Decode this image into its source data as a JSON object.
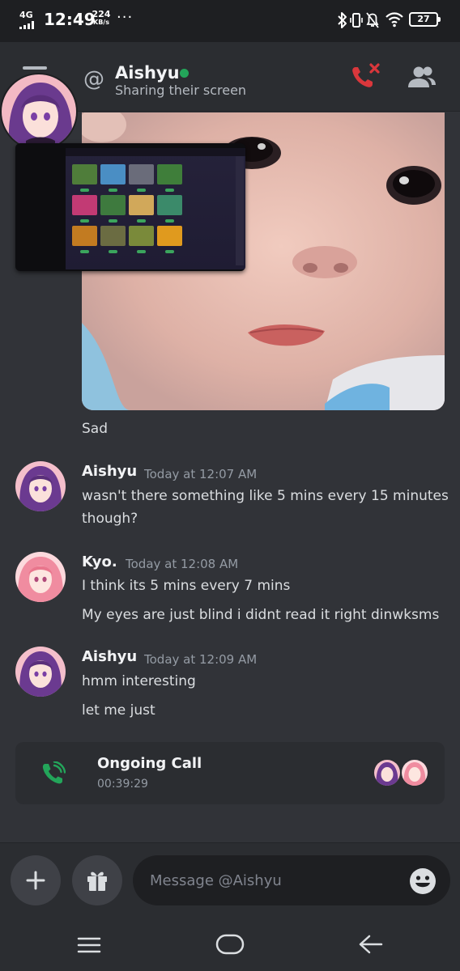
{
  "status_bar": {
    "network": "4G",
    "time": "12:49",
    "speed_value": "224",
    "speed_unit": "KB/s",
    "more": "···",
    "battery": "27",
    "icons": [
      "signal-icon",
      "bluetooth-icon",
      "vibrate-icon",
      "mute-bell-icon",
      "wifi-icon",
      "battery-icon"
    ]
  },
  "header": {
    "at_symbol": "@",
    "name": "Aishyu",
    "subtitle": "Sharing their screen",
    "status_color": "#23a55a",
    "hangup_color": "#da373c"
  },
  "attachment": {
    "caption": "Sad"
  },
  "messages": [
    {
      "author": "Aishyu",
      "timestamp": "Today at 12:07 AM",
      "lines": [
        "wasn't there something like 5 mins every 15 minutes",
        "though?"
      ]
    },
    {
      "author": "Kyo.",
      "timestamp": "Today at 12:08 AM",
      "lines": [
        "I think its 5 mins every 7 mins",
        "My eyes are just blind i didnt read it right dinwksms"
      ]
    },
    {
      "author": "Aishyu",
      "timestamp": "Today at 12:09 AM",
      "lines": [
        "hmm interesting",
        "let me just"
      ]
    }
  ],
  "call": {
    "title": "Ongoing Call",
    "duration": "00:39:29",
    "accent": "#23a55a"
  },
  "composer": {
    "placeholder": "Message @Aishyu"
  },
  "colors": {
    "background": "#313338",
    "surface": "#2b2d31",
    "input": "#1e1f22"
  }
}
